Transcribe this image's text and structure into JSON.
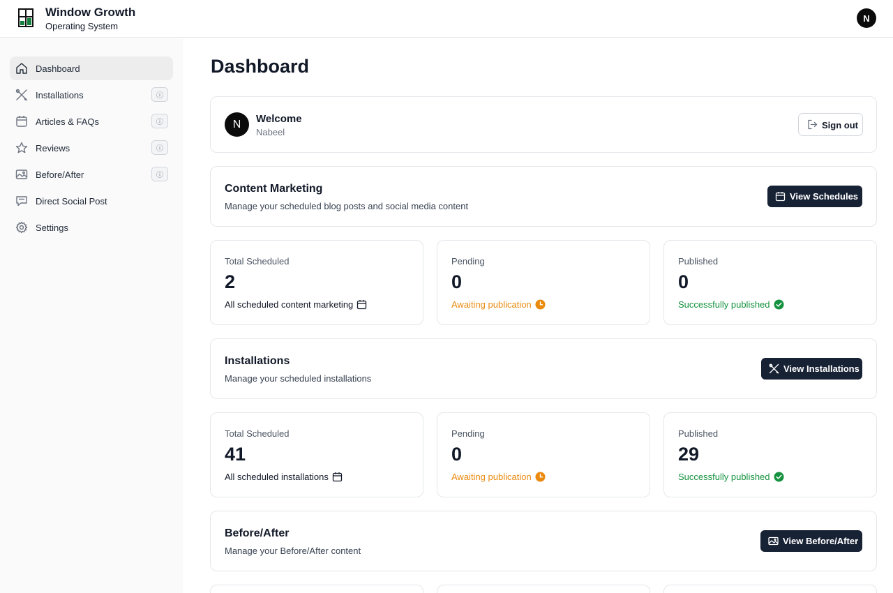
{
  "app": {
    "title": "Window Growth",
    "subtitle": "Operating System",
    "user_initial": "N"
  },
  "sidebar": {
    "items": [
      {
        "label": "Dashboard",
        "icon": "home-icon",
        "active": true
      },
      {
        "label": "Installations",
        "icon": "tools-icon",
        "info": "ⓘ"
      },
      {
        "label": "Articles & FAQs",
        "icon": "calendar-icon",
        "info": "ⓘ"
      },
      {
        "label": "Reviews",
        "icon": "star-icon",
        "info": "ⓘ"
      },
      {
        "label": "Before/After",
        "icon": "image-icon",
        "info": "ⓘ"
      },
      {
        "label": "Direct Social Post",
        "icon": "chat-icon"
      },
      {
        "label": "Settings",
        "icon": "gear-icon"
      }
    ]
  },
  "page": {
    "title": "Dashboard"
  },
  "welcome": {
    "title": "Welcome",
    "name": "Nabeel",
    "initial": "N",
    "signout_label": "Sign out"
  },
  "sections": {
    "content_marketing": {
      "title": "Content Marketing",
      "description": "Manage your scheduled blog posts and social media content",
      "button_label": "View Schedules",
      "stats": {
        "total": {
          "label": "Total Scheduled",
          "value": "2",
          "foot": "All scheduled content marketing"
        },
        "pending": {
          "label": "Pending",
          "value": "0",
          "foot": "Awaiting publication"
        },
        "published": {
          "label": "Published",
          "value": "0",
          "foot": "Successfully published"
        }
      }
    },
    "installations": {
      "title": "Installations",
      "description": "Manage your scheduled installations",
      "button_label": "View Installations",
      "stats": {
        "total": {
          "label": "Total Scheduled",
          "value": "41",
          "foot": "All scheduled installations"
        },
        "pending": {
          "label": "Pending",
          "value": "0",
          "foot": "Awaiting publication"
        },
        "published": {
          "label": "Published",
          "value": "29",
          "foot": "Successfully published"
        }
      }
    },
    "before_after": {
      "title": "Before/After",
      "description": "Manage your Before/After content",
      "button_label": "View Before/After"
    }
  },
  "colors": {
    "primary_button": "#182235",
    "pending": "#ea8a0f",
    "published": "#15923f",
    "brand_green": "#15803d"
  }
}
